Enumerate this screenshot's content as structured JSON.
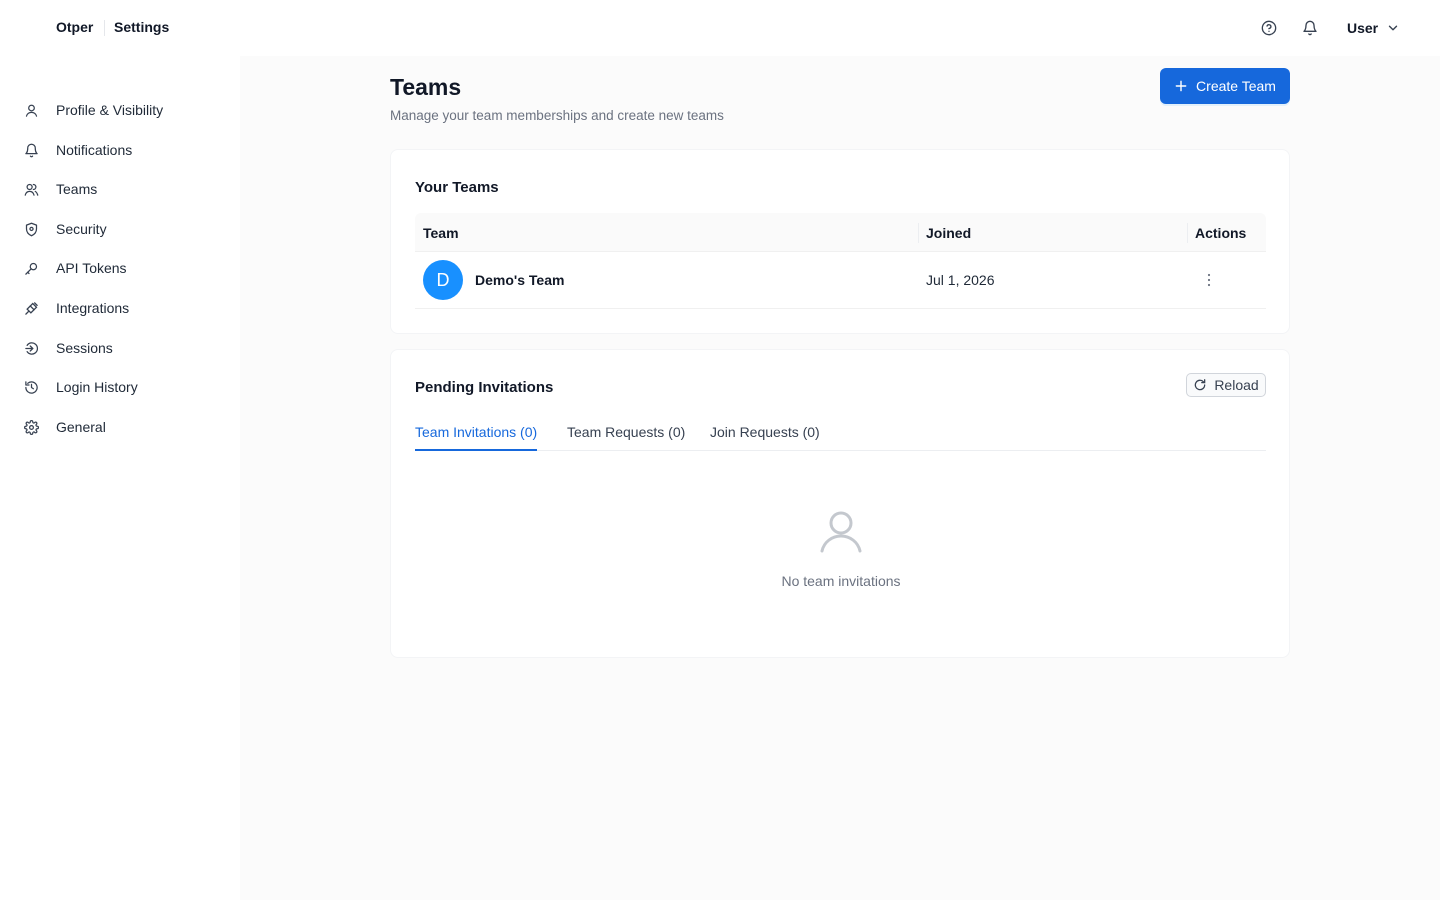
{
  "topbar": {
    "brand": "Otper",
    "section": "Settings",
    "user_label": "User",
    "icons": [
      "help-circle-icon",
      "bell-icon",
      "chevron-down-icon"
    ]
  },
  "sidebar": {
    "items": [
      {
        "label": "Profile & Visibility",
        "icon": "user-icon"
      },
      {
        "label": "Notifications",
        "icon": "bell-icon"
      },
      {
        "label": "Teams",
        "icon": "team-icon"
      },
      {
        "label": "Security",
        "icon": "shield-icon"
      },
      {
        "label": "API Tokens",
        "icon": "key-icon"
      },
      {
        "label": "Integrations",
        "icon": "plug-icon"
      },
      {
        "label": "Sessions",
        "icon": "login-icon"
      },
      {
        "label": "Login History",
        "icon": "history-icon"
      },
      {
        "label": "General",
        "icon": "gear-icon"
      }
    ]
  },
  "page": {
    "title": "Teams",
    "subtitle": "Manage your team memberships and create new teams",
    "create_button": "Create Team"
  },
  "your_teams": {
    "title": "Your Teams",
    "columns": [
      "Team",
      "Joined",
      "Actions"
    ],
    "rows": [
      {
        "avatar": "D",
        "name": "Demo's Team",
        "joined": "Jul 1, 2026"
      }
    ]
  },
  "pending": {
    "title": "Pending Invitations",
    "reload_button": "Reload",
    "tabs": [
      {
        "label": "Team Invitations (0)",
        "active": true
      },
      {
        "label": "Team Requests (0)",
        "active": false
      },
      {
        "label": "Join Requests (0)",
        "active": false
      }
    ],
    "empty_text": "No team invitations"
  },
  "colors": {
    "primary": "#1668dc",
    "avatar": "#1890ff"
  }
}
